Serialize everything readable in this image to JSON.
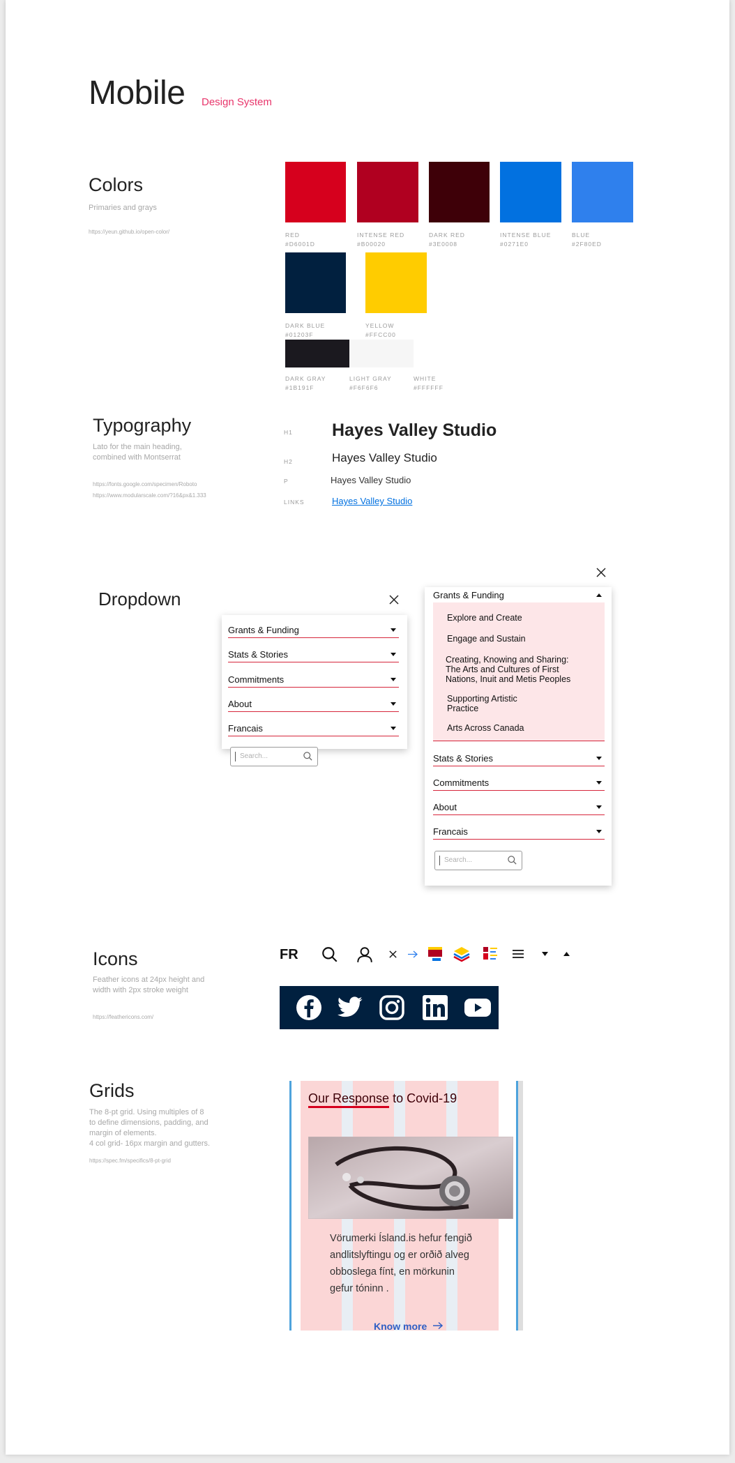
{
  "header": {
    "title": "Mobile",
    "subtitle": "Design System"
  },
  "colors": {
    "title": "Colors",
    "desc": "Primaries and grays",
    "link": "https://yeun.github.io/open-color/",
    "swatches": [
      {
        "name": "RED",
        "hex": "#D6001D",
        "color": "#D6001D"
      },
      {
        "name": "INTENSE RED",
        "hex": "#B00020",
        "color": "#B00020"
      },
      {
        "name": "DARK RED",
        "hex": "#3E0008",
        "color": "#3E0008"
      },
      {
        "name": "INTENSE BLUE",
        "hex": "#0271E0",
        "color": "#0271E0"
      },
      {
        "name": "BLUE",
        "hex": "#2F80ED",
        "color": "#2F80ED"
      },
      {
        "name": "DARK BLUE",
        "hex": "#01203F",
        "color": "#01203F"
      },
      {
        "name": "YELLOW",
        "hex": "#FFCC00",
        "color": "#FFCC00"
      },
      {
        "name": "DARK GRAY",
        "hex": "#1B191F",
        "color": "#1B191F"
      },
      {
        "name": "LIGHT GRAY",
        "hex": "#F6F6F6",
        "color": "#F6F6F6"
      },
      {
        "name": "WHITE",
        "hex": "#FFFFFF",
        "color": "#FFFFFF"
      }
    ]
  },
  "typography": {
    "title": "Typography",
    "desc1": "Lato for the main heading,",
    "desc2": "combined with Montserrat",
    "link1": "https://fonts.google.com/specimen/Roboto",
    "link2": "https://www.modularscale.com/?16&px&1.333",
    "rows": [
      {
        "label": "H1",
        "sample": "Hayes Valley Studio"
      },
      {
        "label": "H2",
        "sample": "Hayes Valley Studio"
      },
      {
        "label": "P",
        "sample": "Hayes Valley Studio"
      },
      {
        "label": "LINKS",
        "sample": "Hayes Valley Studio"
      }
    ]
  },
  "dropdown": {
    "title": "Dropdown",
    "items": [
      "Grants & Funding",
      "Stats & Stories",
      "Commitments",
      "About",
      "Francais"
    ],
    "search_placeholder": "Search...",
    "submenu": [
      "Explore and Create",
      "Engage and Sustain",
      "Creating, Knowing and Sharing:",
      "The Arts and Cultures of First",
      "Nations, Inuit and Metis Peoples",
      "Supporting Artistic",
      "Practice",
      "Arts Across Canada"
    ]
  },
  "icons": {
    "title": "Icons",
    "desc1": "Feather icons at 24px height and",
    "desc2": "width with 2px stroke weight",
    "link": "https://feathericons.com/",
    "lang": "FR",
    "items": [
      "search-icon",
      "user-icon",
      "close-icon",
      "arrow-right-icon",
      "stack-red-icon",
      "layers-icon",
      "list-icon",
      "menu-icon",
      "caret-down-icon",
      "caret-up-icon"
    ],
    "social": [
      "facebook-icon",
      "twitter-icon",
      "instagram-icon",
      "linkedin-icon",
      "youtube-icon"
    ],
    "social_bg": "#01203F"
  },
  "grids": {
    "title": "Grids",
    "desc1": "The 8-pt grid. Using multiples of 8",
    "desc2": "to define dimensions, padding, and",
    "desc3": "margin of elements.",
    "desc4": "4 col grid- 16px margin and gutters.",
    "link": "https://spec.fm/specifics/8-pt-grid",
    "card": {
      "heading_part1": "Our Response",
      "heading_part2": " to Covid-19",
      "body1": "Vörumerki Ísland.is hefur fengið",
      "body2": "andlitslyftingu og er orðið alveg",
      "body3": "obboslega fínt, en mörkunin",
      "body4": "gefur tóninn .",
      "cta": "Know more"
    }
  }
}
